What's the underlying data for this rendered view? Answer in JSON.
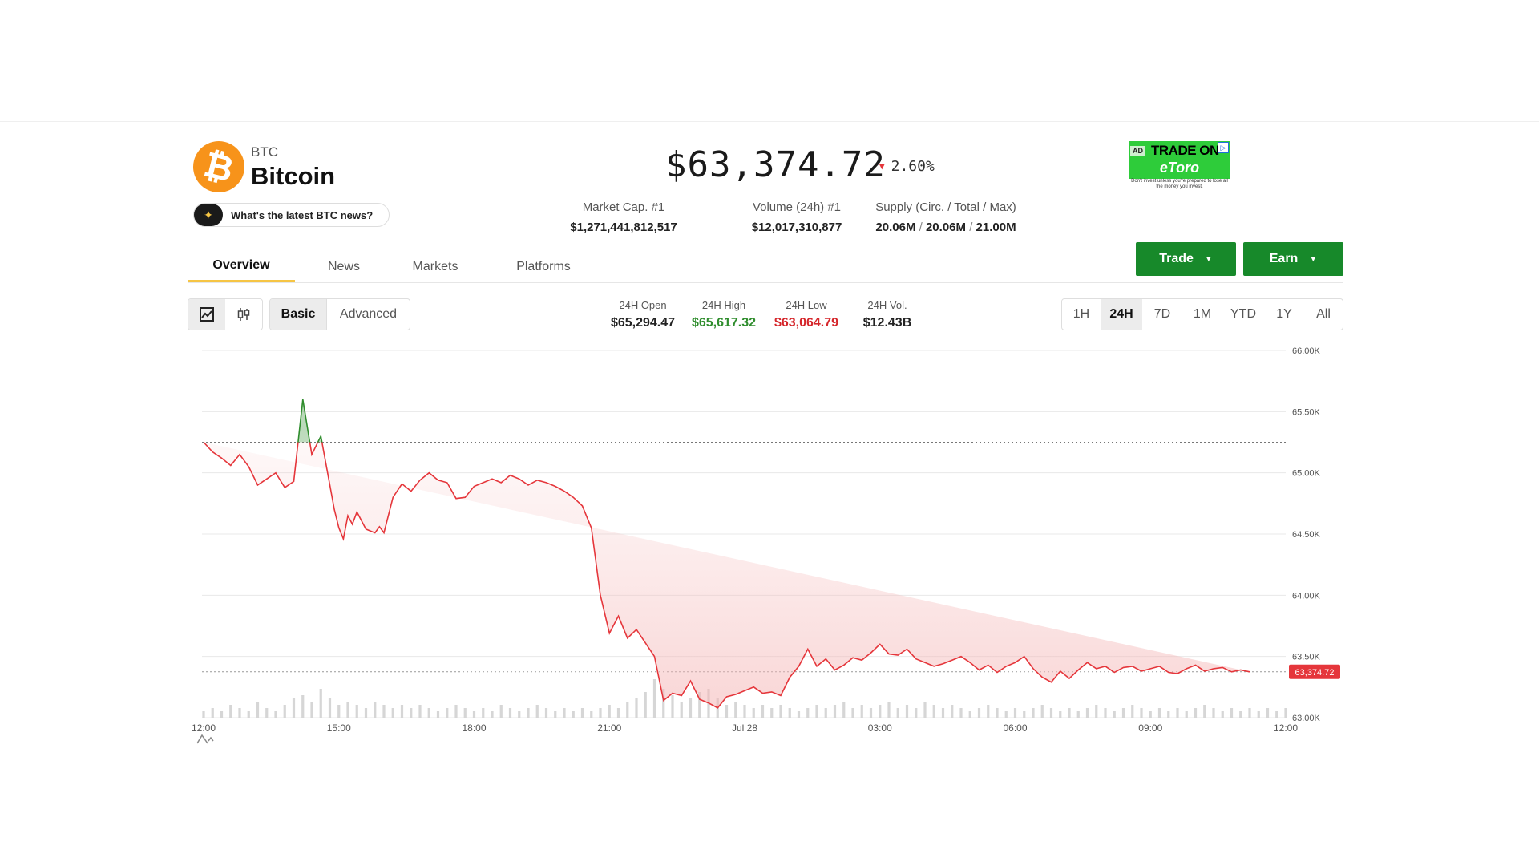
{
  "coin": {
    "symbol": "BTC",
    "name": "Bitcoin",
    "logo_glyph": "₿",
    "logo_color": "#f7931a"
  },
  "news_prompt": {
    "icon": "sparkle-icon",
    "label": "What's the latest BTC news?"
  },
  "price": {
    "value": "$63,374.72",
    "change": "2.60%",
    "direction": "down"
  },
  "stats": [
    {
      "label": "Market Cap. #1",
      "value": "$1,271,441,812,517"
    },
    {
      "label": "Volume (24h) #1",
      "value": "$12,017,310,877"
    },
    {
      "label": "Supply (Circ. / Total / Max)",
      "circ": "20.06M",
      "total": "20.06M",
      "max": "21.00M",
      "sep": "/"
    }
  ],
  "ad": {
    "tag": "AD",
    "title": "TRADE ON",
    "brand": "eToro",
    "info": "▷",
    "disclaimer": "Don't invest unless you're prepared to lose all the money you invest."
  },
  "tabs": [
    {
      "label": "Overview",
      "active": true
    },
    {
      "label": "News",
      "active": false
    },
    {
      "label": "Markets",
      "active": false
    },
    {
      "label": "Platforms",
      "active": false
    }
  ],
  "actions": {
    "trade": "Trade",
    "earn": "Earn"
  },
  "chart_type_toggle": {
    "line": "line-chart-icon",
    "candle": "candlestick-icon"
  },
  "mode_toggle": {
    "basic": "Basic",
    "advanced": "Advanced",
    "selected": "Basic"
  },
  "day_stats": [
    {
      "label": "24H Open",
      "value": "$65,294.47",
      "tone": "neutral"
    },
    {
      "label": "24H High",
      "value": "$65,617.32",
      "tone": "green"
    },
    {
      "label": "24H Low",
      "value": "$63,064.79",
      "tone": "red"
    },
    {
      "label": "24H Vol.",
      "value": "$12.43B",
      "tone": "neutral"
    }
  ],
  "ranges": [
    "1H",
    "24H",
    "7D",
    "1M",
    "YTD",
    "1Y",
    "All"
  ],
  "selected_range": "24H",
  "colors": {
    "up": "#2f8d2d",
    "down": "#e5363b",
    "accent": "#f6c544",
    "button": "#17892a"
  },
  "chart_data": {
    "type": "line",
    "x_ticks": [
      "12:00",
      "15:00",
      "18:00",
      "21:00",
      "Jul 28",
      "03:00",
      "06:00",
      "09:00",
      "12:00"
    ],
    "y_ticks": [
      "66.00K",
      "65.50K",
      "65.00K",
      "64.50K",
      "64.00K",
      "63.50K",
      "63.00K"
    ],
    "ylim": [
      63000,
      66000
    ],
    "baseline": 65250,
    "last_price": 63374.72,
    "last_label": "63,374.72",
    "x_hours": [
      0,
      0.2,
      0.4,
      0.6,
      0.8,
      1,
      1.2,
      1.4,
      1.6,
      1.8,
      2,
      2.2,
      2.4,
      2.6,
      2.8,
      2.9,
      3,
      3.1,
      3.2,
      3.3,
      3.4,
      3.6,
      3.8,
      3.9,
      4,
      4.2,
      4.4,
      4.6,
      4.8,
      5,
      5.2,
      5.4,
      5.6,
      5.8,
      6,
      6.2,
      6.4,
      6.6,
      6.8,
      7,
      7.2,
      7.4,
      7.6,
      7.8,
      8,
      8.2,
      8.4,
      8.6,
      8.8,
      9,
      9.2,
      9.4,
      9.6,
      9.8,
      10,
      10.2,
      10.4,
      10.6,
      10.8,
      11,
      11.2,
      11.4,
      11.6,
      11.8,
      12,
      12.2,
      12.4,
      12.6,
      12.8,
      13,
      13.2,
      13.4,
      13.6,
      13.8,
      14,
      14.2,
      14.4,
      14.6,
      14.8,
      15,
      15.2,
      15.4,
      15.6,
      15.8,
      16,
      16.2,
      16.4,
      16.6,
      16.8,
      17,
      17.2,
      17.4,
      17.6,
      17.8,
      18,
      18.2,
      18.4,
      18.6,
      18.8,
      19,
      19.2,
      19.4,
      19.6,
      19.8,
      20,
      20.2,
      20.4,
      20.6,
      20.8,
      21,
      21.2,
      21.4,
      21.6,
      21.8,
      22,
      22.2,
      22.4,
      22.6,
      22.8,
      23,
      23.2,
      23.4,
      23.6,
      23.8,
      24
    ],
    "price": [
      65250,
      65170,
      65120,
      65060,
      65150,
      65050,
      64900,
      64950,
      65000,
      64880,
      64930,
      65600,
      65150,
      65300,
      64900,
      64700,
      64550,
      64460,
      64650,
      64580,
      64680,
      64540,
      64510,
      64560,
      64510,
      64800,
      64910,
      64850,
      64940,
      65000,
      64940,
      64920,
      64790,
      64800,
      64890,
      64920,
      64950,
      64920,
      64980,
      64950,
      64900,
      64940,
      64920,
      64890,
      64850,
      64800,
      64730,
      64550,
      64000,
      63690,
      63830,
      63650,
      63720,
      63610,
      63500,
      63140,
      63200,
      63180,
      63300,
      63150,
      63120,
      63080,
      63170,
      63190,
      63220,
      63250,
      63200,
      63210,
      63180,
      63330,
      63420,
      63560,
      63420,
      63480,
      63390,
      63430,
      63490,
      63470,
      63530,
      63600,
      63520,
      63510,
      63560,
      63480,
      63450,
      63420,
      63440,
      63470,
      63500,
      63450,
      63390,
      63430,
      63370,
      63420,
      63450,
      63500,
      63400,
      63330,
      63290,
      63380,
      63320,
      63390,
      63450,
      63400,
      63420,
      63370,
      63410,
      63420,
      63380,
      63400,
      63420,
      63370,
      63360,
      63400,
      63430,
      63380,
      63400,
      63410,
      63374.72,
      63390,
      63374.72
    ],
    "volume": [
      2,
      3,
      2,
      4,
      3,
      2,
      5,
      3,
      2,
      4,
      6,
      7,
      5,
      9,
      6,
      4,
      5,
      4,
      3,
      5,
      4,
      3,
      4,
      3,
      4,
      3,
      2,
      3,
      4,
      3,
      2,
      3,
      2,
      4,
      3,
      2,
      3,
      4,
      3,
      2,
      3,
      2,
      3,
      2,
      3,
      4,
      3,
      5,
      6,
      8,
      12,
      9,
      7,
      5,
      6,
      8,
      9,
      6,
      4,
      5,
      4,
      3,
      4,
      3,
      4,
      3,
      2,
      3,
      4,
      3,
      4,
      5,
      3,
      4,
      3,
      4,
      5,
      3,
      4,
      3,
      5,
      4,
      3,
      4,
      3,
      2,
      3,
      4,
      3,
      2,
      3,
      2,
      3,
      4,
      3,
      2,
      3,
      2,
      3,
      4,
      3,
      2,
      3,
      4,
      3,
      2,
      3,
      2,
      3,
      2,
      3,
      4,
      3,
      2,
      3,
      2,
      3,
      2,
      3,
      2,
      3
    ]
  }
}
